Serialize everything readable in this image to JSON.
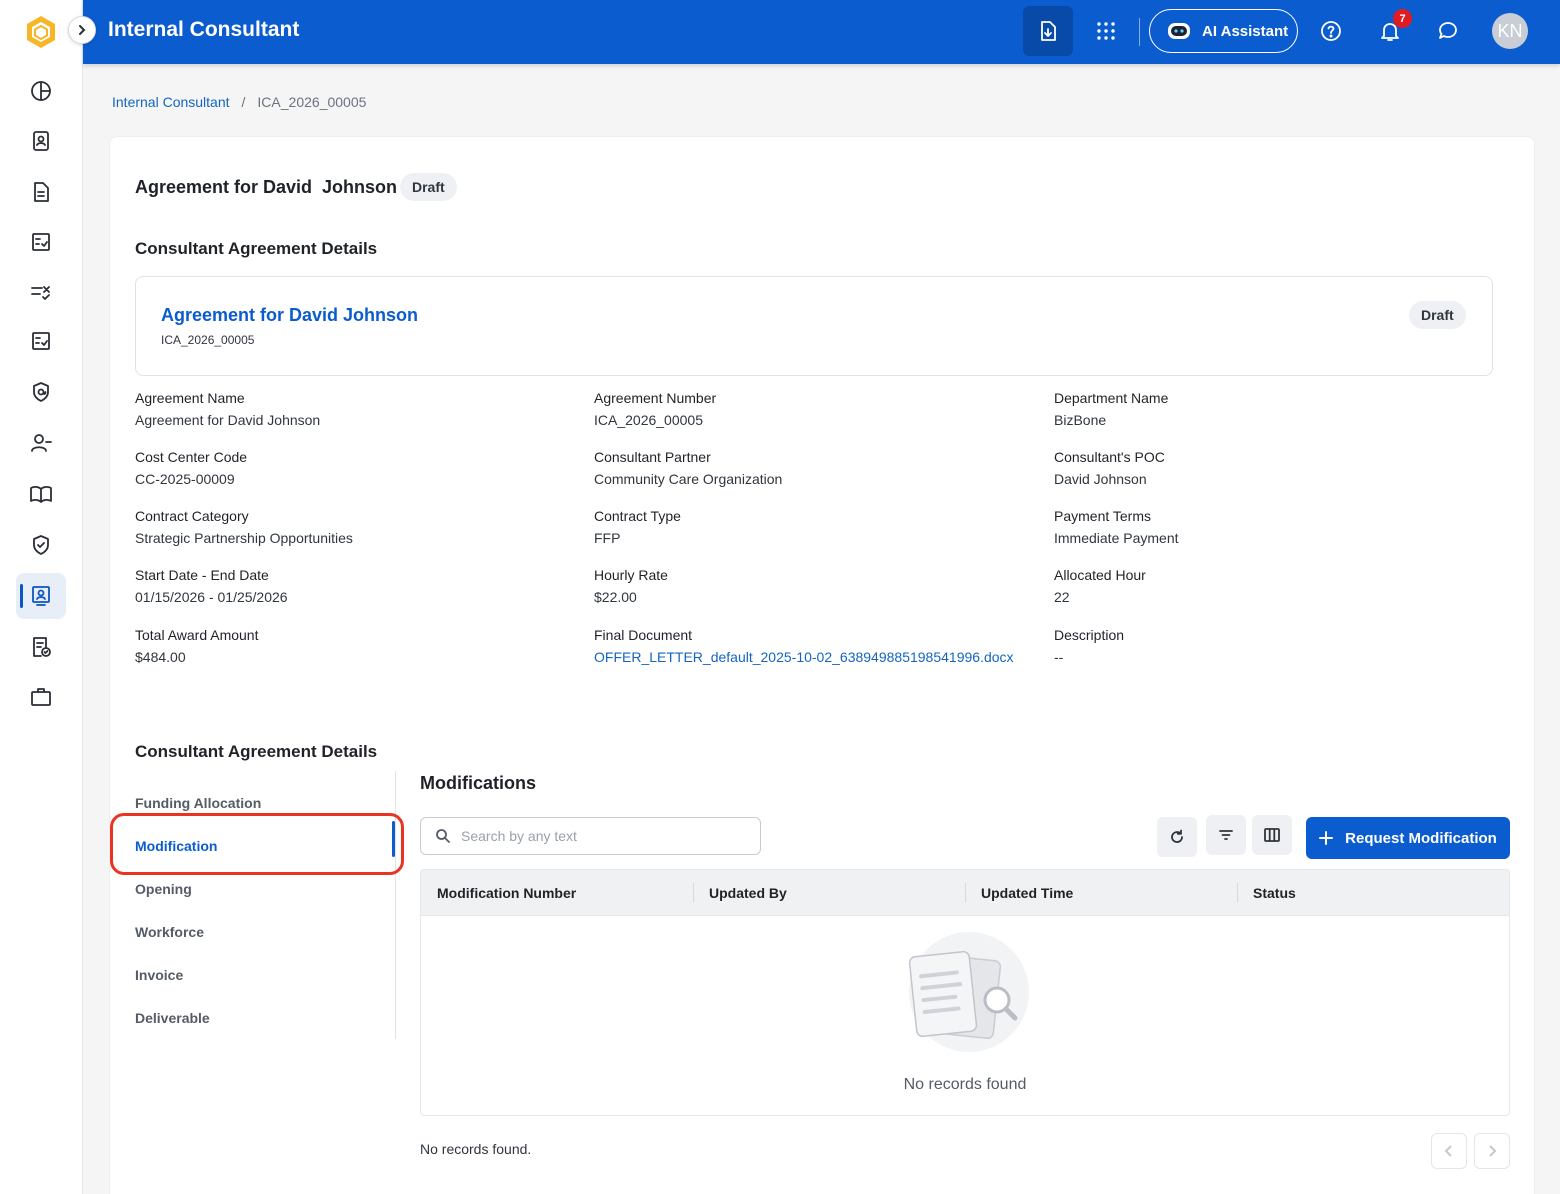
{
  "header": {
    "title": "Internal Consultant",
    "ai_label": "AI Assistant",
    "notification_count": "7",
    "avatar_initials": "KN"
  },
  "breadcrumb": {
    "root": "Internal Consultant",
    "separator": "/",
    "current": "ICA_2026_00005"
  },
  "page": {
    "title": "Agreement for David  Johnson",
    "status": "Draft",
    "details_title": "Consultant Agreement Details",
    "lower_title": "Consultant Agreement Details"
  },
  "summary": {
    "name": "Agreement for David Johnson",
    "number": "ICA_2026_00005",
    "status": "Draft"
  },
  "fields": [
    {
      "label": "Agreement Name",
      "value": "Agreement for David Johnson"
    },
    {
      "label": "Agreement Number",
      "value": "ICA_2026_00005"
    },
    {
      "label": "Department Name",
      "value": "BizBone"
    },
    {
      "label": "Cost Center Code",
      "value": "CC-2025-00009"
    },
    {
      "label": "Consultant Partner",
      "value": "Community Care Organization"
    },
    {
      "label": "Consultant's POC",
      "value": "David Johnson"
    },
    {
      "label": "Contract Category",
      "value": "Strategic Partnership Opportunities"
    },
    {
      "label": "Contract Type",
      "value": "FFP"
    },
    {
      "label": "Payment Terms",
      "value": "Immediate Payment"
    },
    {
      "label": "Start Date - End Date",
      "value": "01/15/2026 - 01/25/2026"
    },
    {
      "label": "Hourly Rate",
      "value": "$22.00"
    },
    {
      "label": "Allocated Hour",
      "value": "22"
    },
    {
      "label": "Total Award Amount",
      "value": "$484.00"
    },
    {
      "label": "Final Document",
      "value": "OFFER_LETTER_default_2025-10-02_638949885198541996.docx"
    },
    {
      "label": "Description",
      "value": "--"
    }
  ],
  "tabs": [
    "Funding Allocation",
    "Modification",
    "Opening",
    "Workforce",
    "Invoice",
    "Deliverable"
  ],
  "modifications": {
    "title": "Modifications",
    "search_placeholder": "Search by any text",
    "request_button": "Request Modification",
    "columns": [
      "Modification Number",
      "Updated By",
      "Updated Time",
      "Status"
    ],
    "empty_message": "No records found",
    "footer_message": "No records found."
  }
}
